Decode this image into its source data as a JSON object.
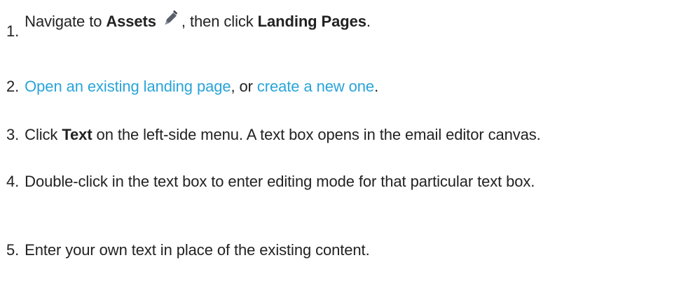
{
  "steps": [
    {
      "number": "1.",
      "prefix": "Navigate to ",
      "bold1": "Assets",
      "icon": "pencil-edit-icon",
      "middle": ", then click ",
      "bold2": "Landing Pages",
      "suffix": "."
    },
    {
      "number": "2.",
      "link1": "Open an existing landing page",
      "middle": ", or ",
      "link2": "create a new one",
      "suffix": "."
    },
    {
      "number": "3.",
      "prefix": "Click ",
      "bold1": "Text",
      "suffix": " on the left-side menu. A text box opens in the email editor canvas."
    },
    {
      "number": "4.",
      "text": "Double-click in the text box to enter editing mode for that particular text box."
    },
    {
      "number": "5.",
      "text": "Enter your own text in place of the existing content."
    }
  ],
  "colors": {
    "link": "#29a4d9",
    "text": "#222222",
    "icon": "#5a5f6b"
  }
}
